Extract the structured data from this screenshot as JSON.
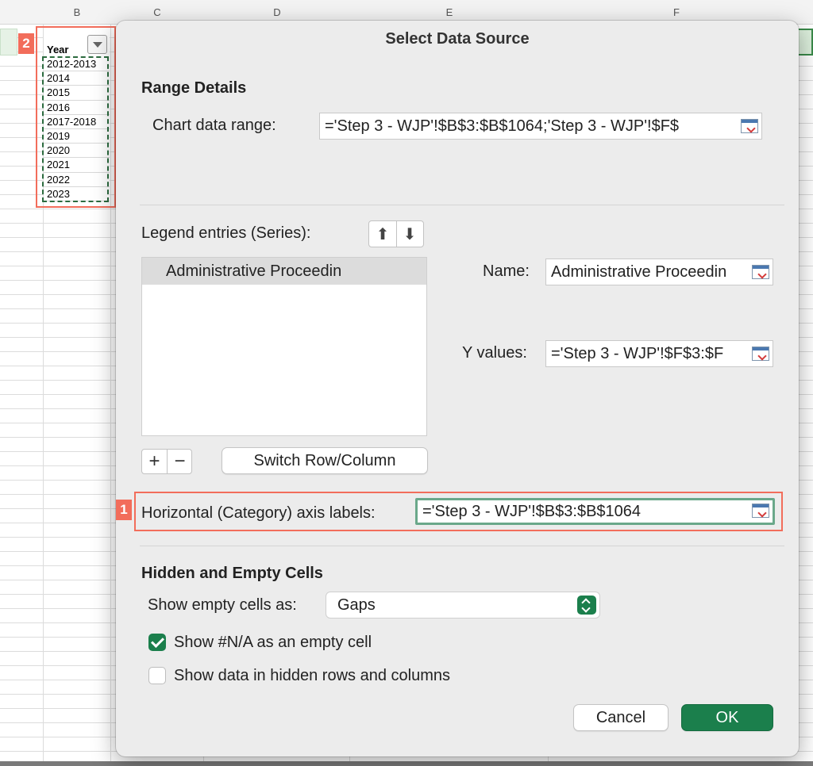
{
  "spreadsheet": {
    "columns": [
      "B",
      "C",
      "D",
      "E",
      "F"
    ],
    "year_header": "Year",
    "years": [
      "2012-2013",
      "2014",
      "2015",
      "2016",
      "2017-2018",
      "2019",
      "2020",
      "2021",
      "2022",
      "2023"
    ],
    "callout_2": "2"
  },
  "dialog": {
    "title": "Select Data Source",
    "range_details": {
      "heading": "Range Details",
      "chart_data_range_label": "Chart data range:",
      "chart_data_range_value": "='Step 3 - WJP'!$B$3:$B$1064;'Step 3 - WJP'!$F$"
    },
    "legend": {
      "label": "Legend entries (Series):",
      "series": [
        "Administrative Proceedin"
      ],
      "name_label": "Name:",
      "name_value": "Administrative Proceedin",
      "y_values_label": "Y values:",
      "y_values_value": "='Step 3 - WJP'!$F$3:$F",
      "plus": "+",
      "minus": "−",
      "switch_button": "Switch Row/Column"
    },
    "axis": {
      "callout_1": "1",
      "label": "Horizontal (Category) axis labels:",
      "value": "='Step 3 - WJP'!$B$3:$B$1064"
    },
    "hidden_empty": {
      "heading": "Hidden and Empty Cells",
      "show_empty_label": "Show empty cells as:",
      "show_empty_value": "Gaps",
      "na_label": "Show #N/A as an empty cell",
      "na_checked": true,
      "hidden_label": "Show data in hidden rows and columns",
      "hidden_checked": false
    },
    "buttons": {
      "cancel": "Cancel",
      "ok": "OK"
    }
  },
  "colors": {
    "accent_green": "#1b7f4c",
    "callout_red": "#f26d5b",
    "focus_border": "#6aa88a"
  }
}
